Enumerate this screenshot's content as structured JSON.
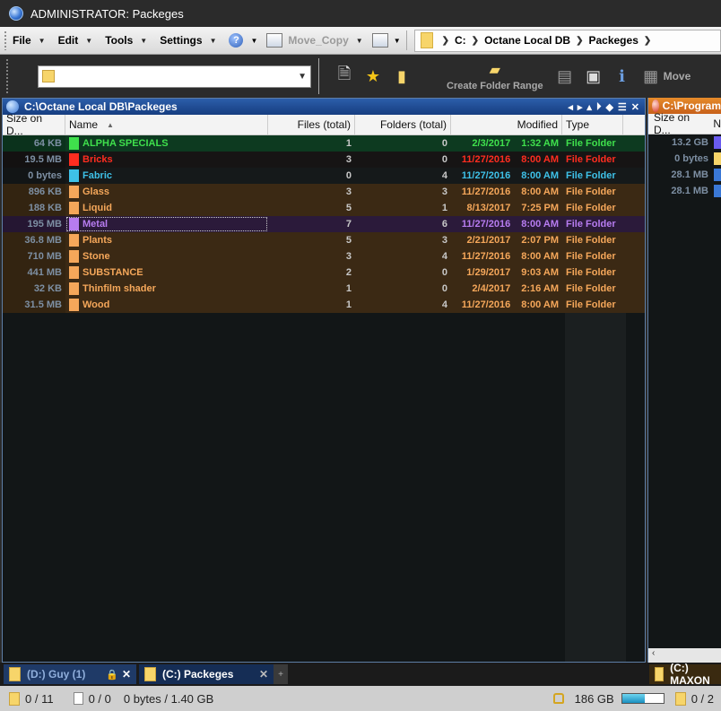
{
  "window": {
    "title": "ADMINISTRATOR: Packeges"
  },
  "menu": {
    "items": [
      "File",
      "Edit",
      "Tools",
      "Settings"
    ],
    "move_copy_label": "Move_Copy"
  },
  "breadcrumb": {
    "parts": [
      "C:",
      "Octane Local DB",
      "Packeges"
    ]
  },
  "toolbar": {
    "create_folder_range": "Create Folder Range",
    "move_label": "Move"
  },
  "left_pane": {
    "path": "C:\\Octane Local DB\\Packeges",
    "columns": {
      "size": "Size on D...",
      "name": "Name",
      "files": "Files (total)",
      "folders": "Folders (total)",
      "modified": "Modified",
      "type": "Type"
    },
    "rows": [
      {
        "size": "64 KB",
        "name": "ALPHA SPECIALS",
        "files": "1",
        "folders": "0",
        "date": "2/3/2017",
        "time": "1:32 AM",
        "type": "File Folder",
        "color": "#3fe04c"
      },
      {
        "size": "19.5 MB",
        "name": "Bricks",
        "files": "3",
        "folders": "0",
        "date": "11/27/2016",
        "time": "8:00 AM",
        "type": "File Folder",
        "color": "#ff2d20"
      },
      {
        "size": "0 bytes",
        "name": "Fabric",
        "files": "0",
        "folders": "4",
        "date": "11/27/2016",
        "time": "8:00 AM",
        "type": "File Folder",
        "color": "#3ec1e8"
      },
      {
        "size": "896 KB",
        "name": "Glass",
        "files": "3",
        "folders": "3",
        "date": "11/27/2016",
        "time": "8:00 AM",
        "type": "File Folder",
        "color": "#f5a75a"
      },
      {
        "size": "188 KB",
        "name": "Liquid",
        "files": "5",
        "folders": "1",
        "date": "8/13/2017",
        "time": "7:25 PM",
        "type": "File Folder",
        "color": "#f5a75a"
      },
      {
        "size": "195 MB",
        "name": "Metal",
        "files": "7",
        "folders": "6",
        "date": "11/27/2016",
        "time": "8:00 AM",
        "type": "File Folder",
        "color": "#b77cf0"
      },
      {
        "size": "36.8 MB",
        "name": "Plants",
        "files": "5",
        "folders": "3",
        "date": "2/21/2017",
        "time": "2:07 PM",
        "type": "File Folder",
        "color": "#f5a75a"
      },
      {
        "size": "710 MB",
        "name": "Stone",
        "files": "3",
        "folders": "4",
        "date": "11/27/2016",
        "time": "8:00 AM",
        "type": "File Folder",
        "color": "#f5a75a"
      },
      {
        "size": "441 MB",
        "name": "SUBSTANCE",
        "files": "2",
        "folders": "0",
        "date": "1/29/2017",
        "time": "9:03 AM",
        "type": "File Folder",
        "color": "#f5a75a"
      },
      {
        "size": "32 KB",
        "name": "Thinfilm shader",
        "files": "1",
        "folders": "0",
        "date": "2/4/2017",
        "time": "2:16 AM",
        "type": "File Folder",
        "color": "#f5a75a"
      },
      {
        "size": "31.5 MB",
        "name": "Wood",
        "files": "1",
        "folders": "4",
        "date": "11/27/2016",
        "time": "8:00 AM",
        "type": "File Folder",
        "color": "#f5a75a"
      }
    ]
  },
  "right_pane": {
    "path": "C:\\Program",
    "col_size": "Size on D...",
    "col_name": "N",
    "rows": [
      "13.2 GB",
      "0 bytes",
      "28.1 MB",
      "28.1 MB"
    ]
  },
  "tabs": {
    "left": [
      {
        "label": "(D:) Guy  (1)"
      },
      {
        "label": "(C:) Packeges"
      }
    ],
    "right": {
      "label": "(C:) MAXON"
    }
  },
  "status": {
    "folders": "0 / 11",
    "files": "0 / 0",
    "size": "0 bytes / 1.40 GB",
    "free": "186 GB",
    "disk_used_fraction": 0.55,
    "right_folders": "0 / 2"
  }
}
